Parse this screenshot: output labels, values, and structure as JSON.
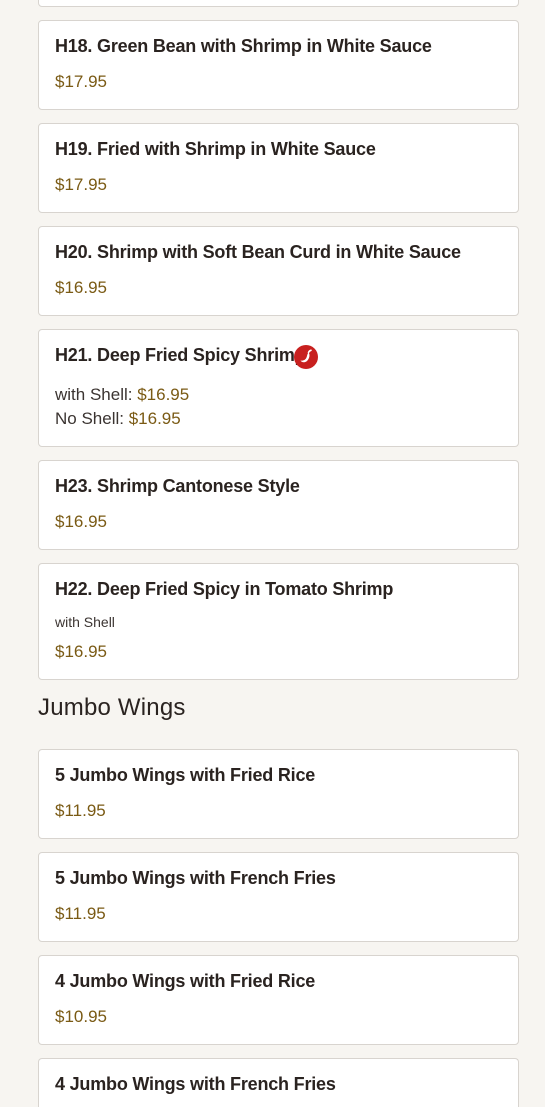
{
  "shrimp_items": [
    {
      "title": "H18. Green Bean with Shrimp in White Sauce",
      "price": "$17.95"
    },
    {
      "title": "H19. Fried with Shrimp in White Sauce",
      "price": "$17.95"
    },
    {
      "title": "H20. Shrimp with Soft Bean Curd in White Sauce",
      "price": "$16.95"
    },
    {
      "title": "H21. Deep Fried Spicy Shrimp",
      "spicy": true,
      "options": [
        {
          "label": "with Shell:",
          "price": "$16.95"
        },
        {
          "label": "No Shell:",
          "price": "$16.95"
        }
      ]
    },
    {
      "title": "H23. Shrimp Cantonese Style",
      "price": "$16.95"
    },
    {
      "title": "H22. Deep Fried Spicy in Tomato Shrimp",
      "note": "with Shell",
      "price": "$16.95"
    }
  ],
  "jumbo_wings": {
    "section_title": "Jumbo Wings",
    "items": [
      {
        "title": "5 Jumbo Wings with Fried Rice",
        "price": "$11.95"
      },
      {
        "title": "5 Jumbo Wings with French Fries",
        "price": "$11.95"
      },
      {
        "title": "4 Jumbo Wings with Fried Rice",
        "price": "$10.95"
      },
      {
        "title": "4 Jumbo Wings with French Fries"
      }
    ]
  },
  "colors": {
    "price": "#7a5a14",
    "spicy_icon": "#c8201f",
    "card_border": "#d8d4cf",
    "background": "#f7f5f1"
  },
  "icons": {
    "spicy": "chili-pepper-icon"
  }
}
